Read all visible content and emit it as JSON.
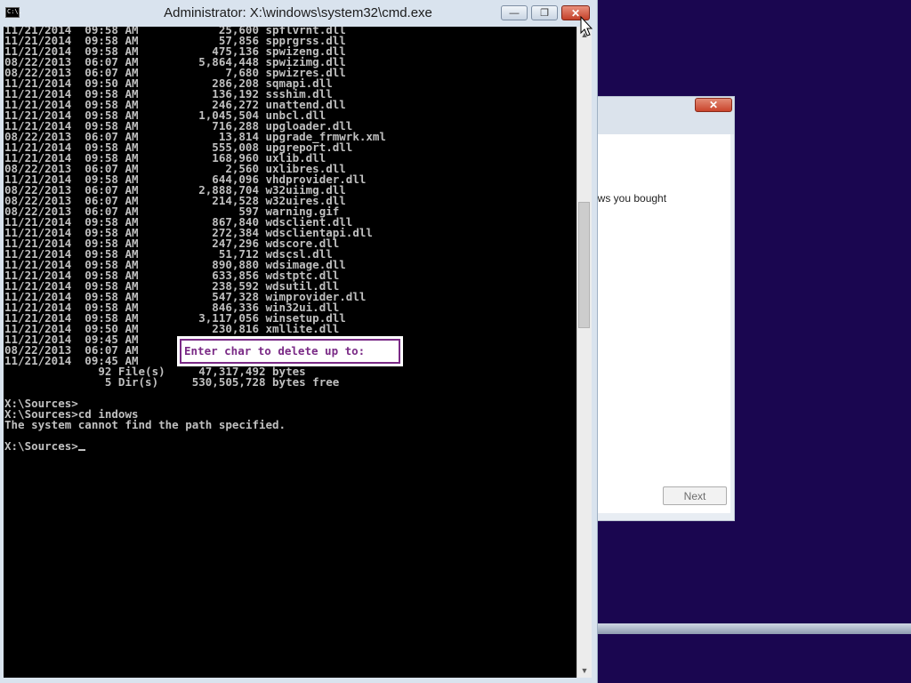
{
  "window": {
    "title": "Administrator: X:\\windows\\system32\\cmd.exe",
    "icon_text": "C:\\.",
    "icon": "cmd-icon"
  },
  "console": {
    "lines": [
      "11/21/2014  09:58 AM            25,600 spflvrnt.dll",
      "11/21/2014  09:58 AM            57,856 spprgrss.dll",
      "11/21/2014  09:58 AM           475,136 spwizeng.dll",
      "08/22/2013  06:07 AM         5,864,448 spwizimg.dll",
      "08/22/2013  06:07 AM             7,680 spwizres.dll",
      "11/21/2014  09:50 AM           286,208 sqmapi.dll",
      "11/21/2014  09:58 AM           136,192 ssshim.dll",
      "11/21/2014  09:58 AM           246,272 unattend.dll",
      "11/21/2014  09:58 AM         1,045,504 unbcl.dll",
      "11/21/2014  09:58 AM           716,288 upgloader.dll",
      "08/22/2013  06:07 AM            13,814 upgrade_frmwrk.xml",
      "11/21/2014  09:58 AM           555,008 upgreport.dll",
      "11/21/2014  09:58 AM           168,960 uxlib.dll",
      "08/22/2013  06:07 AM             2,560 uxlibres.dll",
      "11/21/2014  09:58 AM           644,096 vhdprovider.dll",
      "08/22/2013  06:07 AM         2,888,704 w32uiimg.dll",
      "08/22/2013  06:07 AM           214,528 w32uires.dll",
      "08/22/2013  06:07 AM               597 warning.gif",
      "11/21/2014  09:58 AM           867,840 wdsclient.dll",
      "11/21/2014  09:58 AM           272,384 wdsclientapi.dll",
      "11/21/2014  09:58 AM           247,296 wdscore.dll",
      "11/21/2014  09:58 AM            51,712 wdscsl.dll",
      "11/21/2014  09:58 AM           890,880 wdsimage.dll",
      "11/21/2014  09:58 AM           633,856 wdstptc.dll",
      "11/21/2014  09:58 AM           238,592 wdsutil.dll",
      "11/21/2014  09:58 AM           547,328 wimprovider.dll",
      "11/21/2014  09:58 AM           846,336 win32ui.dll",
      "11/21/2014  09:58 AM         3,117,056 winsetup.dll",
      "11/21/2014  09:50 AM           230,816 xmllite.dll",
      "11/21/2014  09:45 AM",
      "08/22/2013  06:07 AM",
      "11/21/2014  09:45 AM",
      "              92 File(s)     47,317,492 bytes",
      "               5 Dir(s)     530,505,728 bytes free",
      "",
      "X:\\Sources>",
      "X:\\Sources>cd indows",
      "The system cannot find the path specified.",
      "",
      "X:\\Sources>"
    ],
    "prompt_box": "Enter char to delete up to:"
  },
  "setup_dialog": {
    "close_label": "✕",
    "text": "ows you bought",
    "next_label": "Next"
  },
  "caption_buttons": {
    "minimize": "—",
    "restore": "❐",
    "close": "✕"
  },
  "scrollbar": {
    "up_arrow": "▲",
    "down_arrow": "▼"
  },
  "colors": {
    "desktop": "#1a0650",
    "console_bg": "#000000",
    "console_text": "#c0c0c0",
    "prompt_box_text": "#7a2a86"
  }
}
